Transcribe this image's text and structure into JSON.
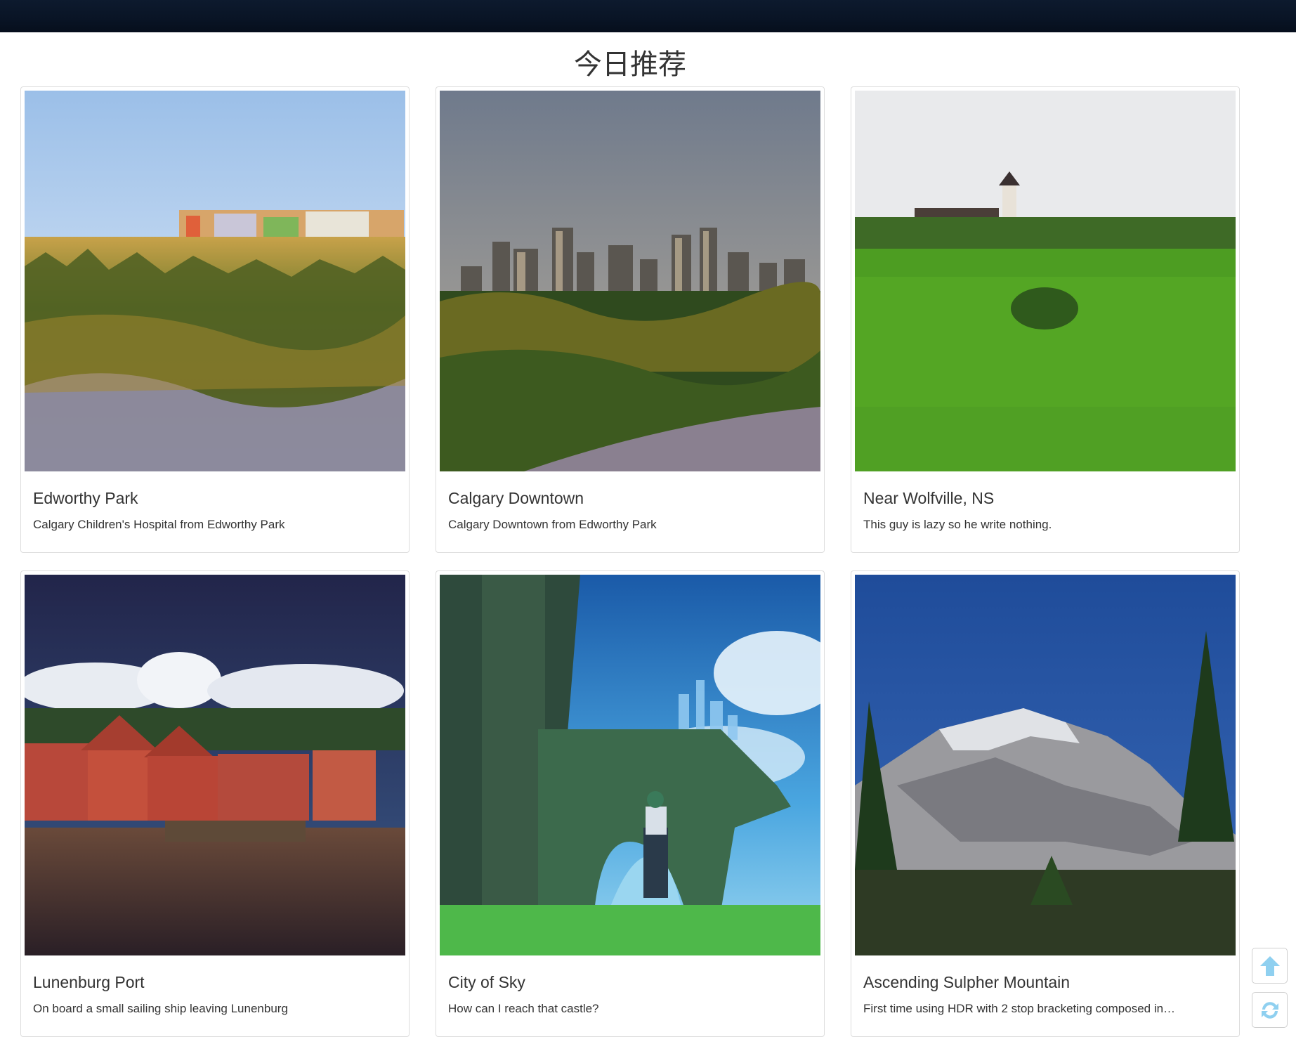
{
  "page": {
    "title": "今日推荐"
  },
  "cards": [
    {
      "title": "Edworthy Park",
      "description": "Calgary Children's Hospital from Edworthy Park",
      "image_icon": "landscape-photo-icon"
    },
    {
      "title": "Calgary Downtown",
      "description": "Calgary Downtown from Edworthy Park",
      "image_icon": "city-skyline-photo-icon"
    },
    {
      "title": "Near Wolfville, NS",
      "description": "This guy is lazy so he write nothing.",
      "image_icon": "field-photo-icon"
    },
    {
      "title": "Lunenburg Port",
      "description": "On board a small sailing ship leaving Lunenburg",
      "image_icon": "harbor-photo-icon"
    },
    {
      "title": "City of Sky",
      "description": "How can I reach that castle?",
      "image_icon": "fantasy-art-photo-icon"
    },
    {
      "title": "Ascending Sulpher Mountain",
      "description": "First time using HDR with 2 stop bracketing composed in…",
      "image_icon": "mountain-photo-icon"
    }
  ],
  "floating_buttons": {
    "scroll_top_icon": "arrow-up-icon",
    "refresh_icon": "refresh-icon",
    "color": "#8fd0f0"
  }
}
